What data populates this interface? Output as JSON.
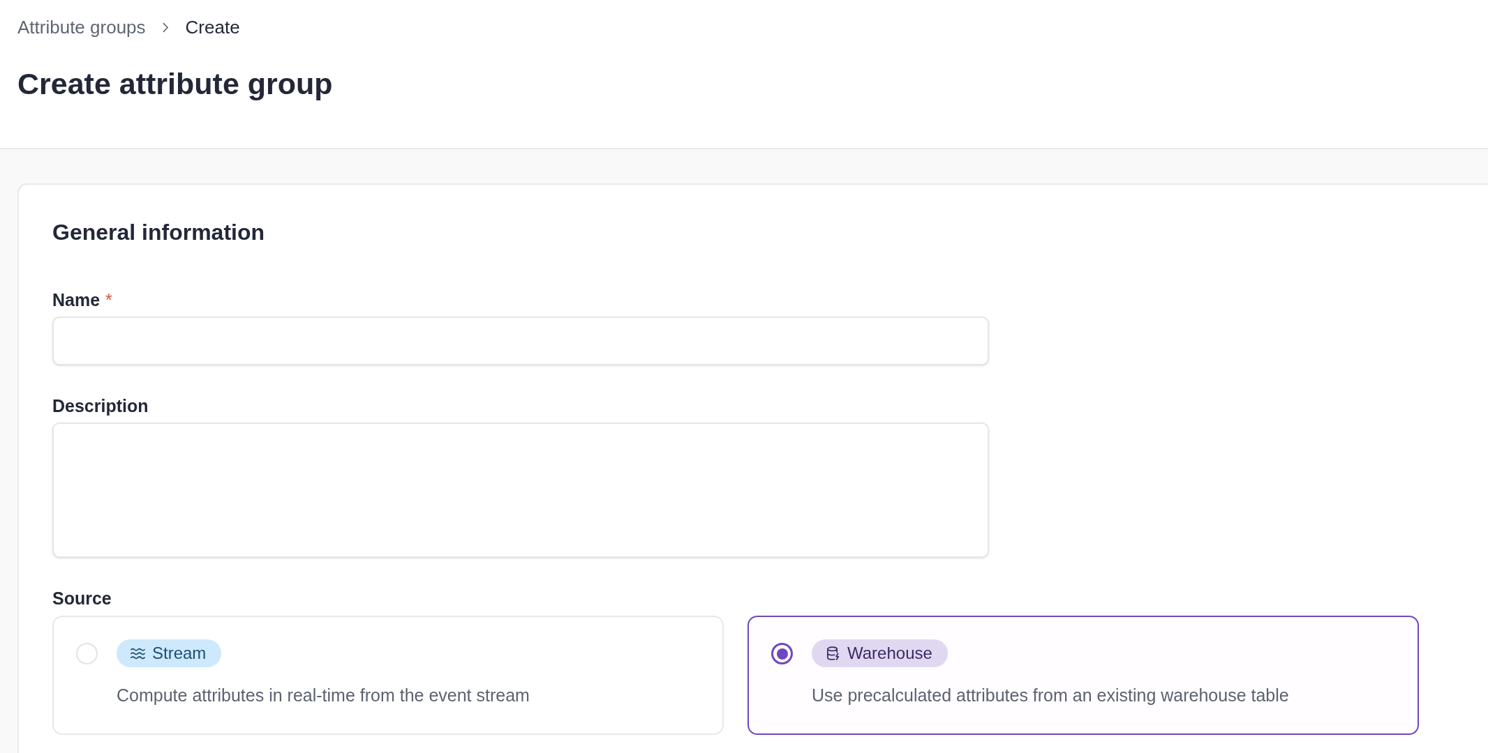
{
  "breadcrumb": [
    {
      "label": "Attribute groups",
      "current": false
    },
    {
      "label": "Create",
      "current": true
    }
  ],
  "title": "Create attribute group",
  "section": {
    "title": "General information",
    "fields": [
      {
        "kind": "input",
        "label": "Name",
        "required_mark": "*"
      },
      {
        "kind": "textarea",
        "label": "Description"
      }
    ],
    "source": {
      "label": "Source",
      "options": [
        {
          "kind": "stream",
          "badge": "Stream",
          "description": "Compute attributes in real-time from the event stream",
          "selected": false
        },
        {
          "kind": "warehouse",
          "badge": "Warehouse",
          "description": "Use precalculated attributes from an existing warehouse table",
          "selected": true
        }
      ]
    }
  }
}
